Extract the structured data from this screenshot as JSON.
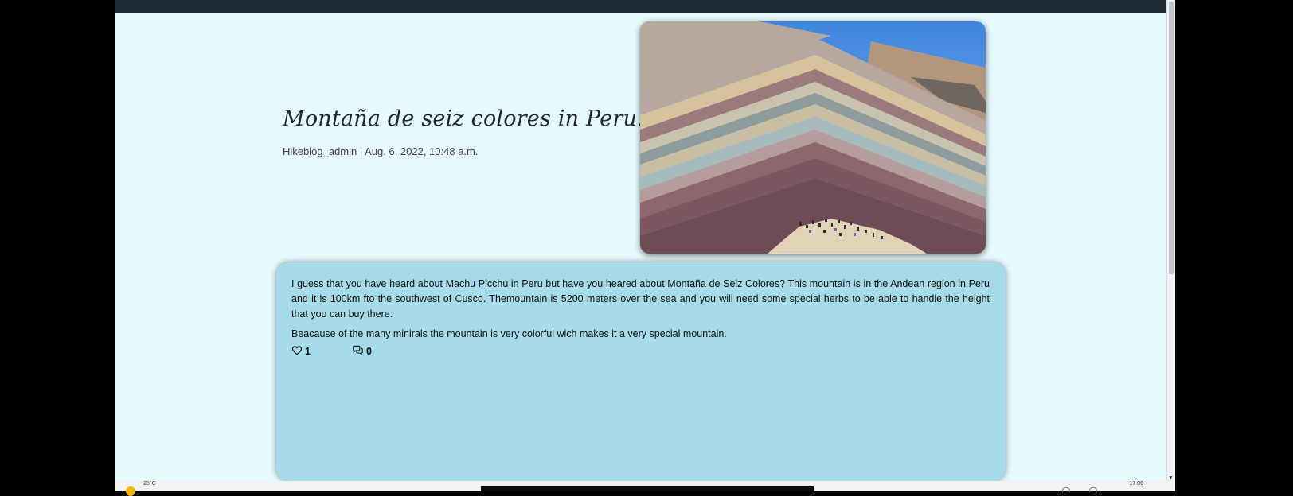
{
  "post": {
    "title": "Montaña de seiz colores in Peru.",
    "meta": "Hikeblog_admin | Aug. 6, 2022, 10:48 a.m.",
    "paragraphs": [
      "I guess that you have heard about Machu Picchu in Peru but have you heared about Montaña de Seiz Colores? This mountain is in the Andean region in Peru and it is 100km fto the southwest of Cusco. Themountain is 5200 meters over the sea and you will need some special herbs to be able to handle the height that you can buy there.",
      "Beacause of the many minirals the mountain is very colorful wich makes it a very special mountain."
    ],
    "likes": "1",
    "comments": "0",
    "like_icon": "heart-outline-icon",
    "comment_icon": "chat-bubbles-icon"
  },
  "taskbar": {
    "weather_temp": "25°C",
    "clock": "17:06"
  },
  "colors": {
    "page_background": "#e5fbff",
    "navbar": "#1e2b36",
    "card_background": "#a6dbea"
  }
}
